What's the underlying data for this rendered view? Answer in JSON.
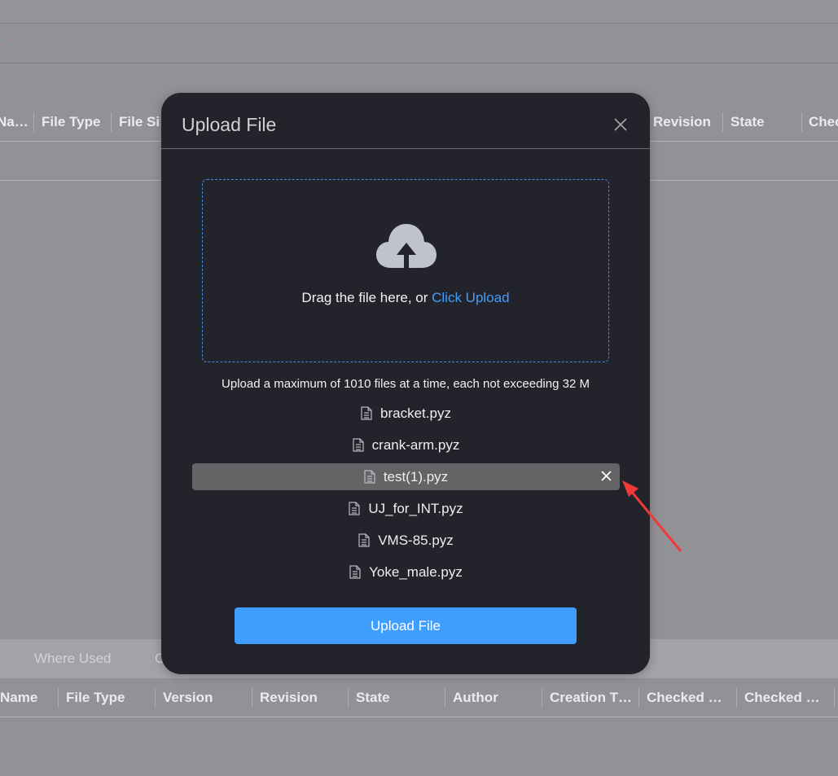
{
  "background": {
    "top_table": {
      "columns": [
        {
          "label": "Na…"
        },
        {
          "label": "File Type"
        },
        {
          "label": "File Si"
        },
        {
          "label": "Revision"
        },
        {
          "label": "State"
        },
        {
          "label": "Chec"
        }
      ]
    },
    "bottom_tabs": [
      {
        "label": "Where Used"
      },
      {
        "label": "C"
      }
    ],
    "bottom_table": {
      "columns": [
        {
          "label": "Name"
        },
        {
          "label": "File Type"
        },
        {
          "label": "Version"
        },
        {
          "label": "Revision"
        },
        {
          "label": "State"
        },
        {
          "label": "Author"
        },
        {
          "label": "Creation T…"
        },
        {
          "label": "Checked …"
        },
        {
          "label": "Checked …"
        }
      ]
    }
  },
  "modal": {
    "title": "Upload File",
    "close_icon": "close-icon",
    "dropzone": {
      "icon": "cloud-upload-icon",
      "text": "Drag the file here, or ",
      "link": "Click Upload"
    },
    "tip": "Upload a maximum of 1010 files at a time, each not exceeding 32 M",
    "files": [
      {
        "name": "bracket.pyz",
        "icon": "document-icon",
        "hovered": false
      },
      {
        "name": "crank-arm.pyz",
        "icon": "document-icon",
        "hovered": false
      },
      {
        "name": "test(1).pyz",
        "icon": "document-icon",
        "hovered": true
      },
      {
        "name": "UJ_for_INT.pyz",
        "icon": "document-icon",
        "hovered": false
      },
      {
        "name": "VMS-85.pyz",
        "icon": "document-icon",
        "hovered": false
      },
      {
        "name": "Yoke_male.pyz",
        "icon": "document-icon",
        "hovered": false
      }
    ],
    "submit_label": "Upload File"
  },
  "colors": {
    "accent": "#409eff",
    "modal_bg": "#23232c",
    "overlay": "#929196",
    "hover_row": "#646466",
    "annotation": "#f03a3a"
  }
}
